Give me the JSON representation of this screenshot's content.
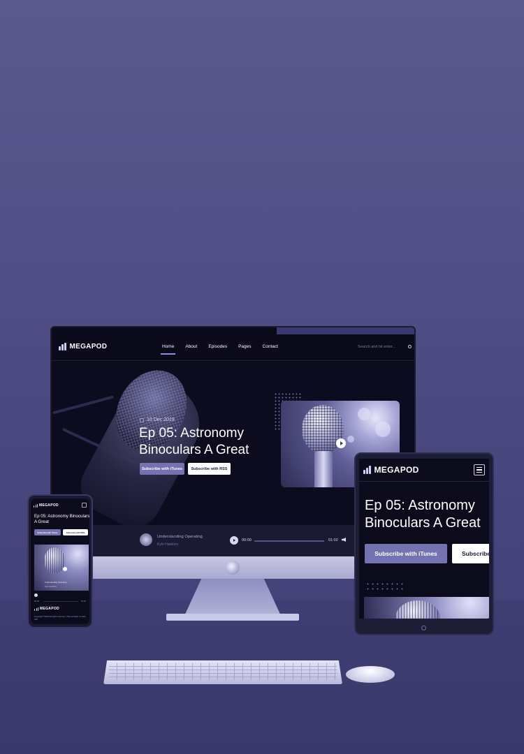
{
  "brand": {
    "name": "MEGAPOD"
  },
  "desktop": {
    "nav": [
      "Home",
      "About",
      "Episodes",
      "Pages",
      "Contact"
    ],
    "search_placeholder": "Search and hit enter...",
    "hero": {
      "date": "10 Dec 2019",
      "title": "Ep 05: Astronomy Binoculars A Great",
      "btn_itunes": "Subscribe with iTunes",
      "btn_rss": "Subscribe with RSS"
    },
    "player": {
      "title": "Understanding Operating",
      "author": "Kyle Hawkins",
      "current": "00:00",
      "duration": "01:02"
    }
  },
  "tablet": {
    "title": "Ep 05: Astronomy Binoculars A Great",
    "btn_itunes": "Subscribe with iTunes",
    "btn_rss": "Subscribe w"
  },
  "phone": {
    "title": "Ep 05: Astronomy Binoculars A Great",
    "btn_itunes": "Subscribe with iTunes",
    "btn_rss": "Subscribe with RSS",
    "player_title": "Understanding Operating",
    "player_author": "Kyle Hawkins",
    "time_a": "00:00",
    "time_b": "01:02",
    "copyright": "Copyright ©2019 All rights reserved | This template is made with"
  },
  "colors": {
    "background": "#4f4e85",
    "accent": "#7473b0",
    "screen": "#0c0b1c"
  }
}
